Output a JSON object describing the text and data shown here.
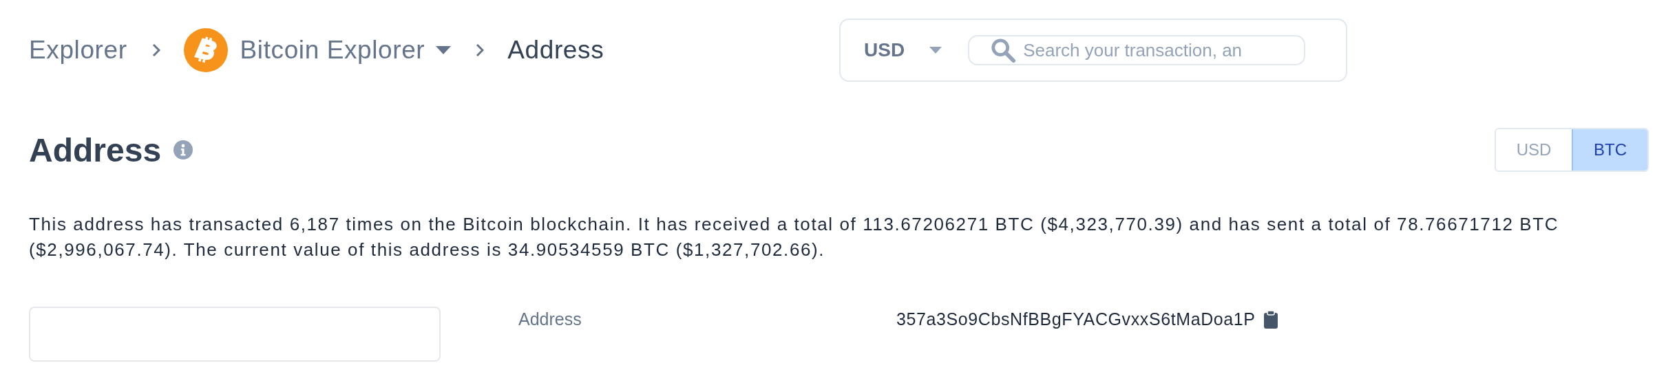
{
  "breadcrumb": {
    "items": [
      "Explorer",
      "Bitcoin Explorer",
      "Address"
    ]
  },
  "header": {
    "currency": "USD",
    "search": {
      "placeholder": "Search your transaction, an"
    }
  },
  "title": "Address",
  "unit_toggle": [
    {
      "label": "USD",
      "selected": false
    },
    {
      "label": "BTC",
      "selected": true
    }
  ],
  "summary": "This address has transacted 6,187 times on the Bitcoin blockchain. It has received a total of 113.67206271 BTC ($4,323,770.39) and has sent a total of 78.76671712 BTC ($2,996,067.74). The current value of this address is 34.90534559 BTC ($1,327,702.66).",
  "details": [
    {
      "label": "Address",
      "value": "357a3So9CbsNfBBgFYACGvxxS6tMaDoa1P"
    }
  ]
}
